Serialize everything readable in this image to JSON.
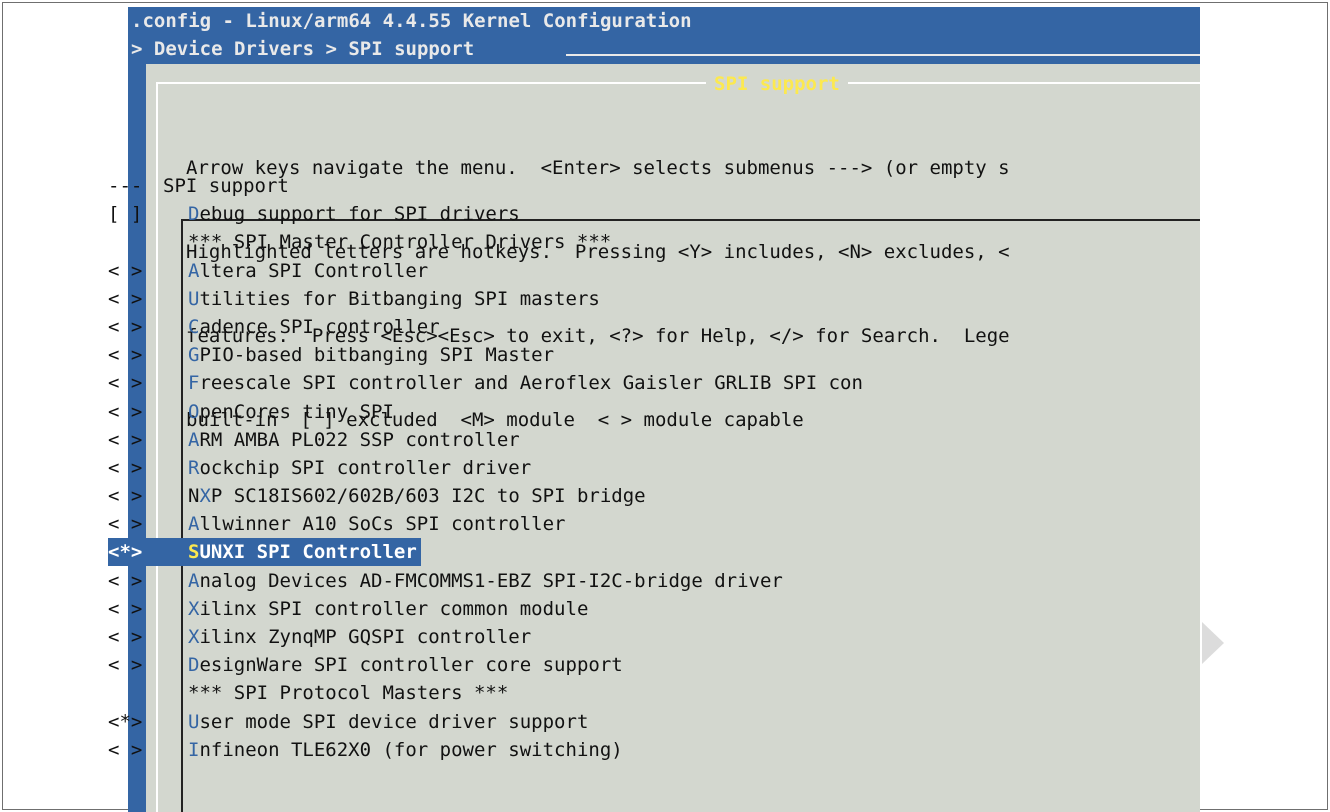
{
  "window": {
    "title": ".config - Linux/arm64 4.4.55 Kernel Configuration",
    "breadcrumb": "> Device Drivers > SPI support"
  },
  "dialog": {
    "title": "SPI support",
    "help_lines": [
      "Arrow keys navigate the menu.  <Enter> selects submenus ---> (or empty s",
      "Highlighted letters are hotkeys.  Pressing <Y> includes, <N> excludes, <",
      "features.  Press <Esc><Esc> to exit, <?> for Help, </> for Search.  Lege",
      "built-in  [ ] excluded  <M> module  < > module capable"
    ]
  },
  "menu": {
    "items": [
      {
        "flag": "---",
        "hotkey": "",
        "rest": "SPI support",
        "kind": "header"
      },
      {
        "flag": "[ ]",
        "hotkey": "D",
        "rest": "ebug support for SPI drivers"
      },
      {
        "flag": "",
        "hotkey": "",
        "rest": "*** SPI Master Controller Drivers ***",
        "kind": "comment"
      },
      {
        "flag": "< >",
        "hotkey": "A",
        "rest": "ltera SPI Controller"
      },
      {
        "flag": "< >",
        "hotkey": "U",
        "rest": "tilities for Bitbanging SPI masters"
      },
      {
        "flag": "< >",
        "hotkey": "C",
        "rest": "adence SPI controller"
      },
      {
        "flag": "< >",
        "hotkey": "G",
        "rest": "PIO-based bitbanging SPI Master"
      },
      {
        "flag": "< >",
        "hotkey": "F",
        "rest": "reescale SPI controller and Aeroflex Gaisler GRLIB SPI con"
      },
      {
        "flag": "< >",
        "hotkey": "O",
        "rest": "penCores tiny SPI"
      },
      {
        "flag": "< >",
        "hotkey": "A",
        "rest": "RM AMBA PL022 SSP controller"
      },
      {
        "flag": "< >",
        "hotkey": "R",
        "rest": "ockchip SPI controller driver"
      },
      {
        "flag": "< >",
        "prefix": "N",
        "hotkey": "X",
        "rest": "P SC18IS602/602B/603 I2C to SPI bridge"
      },
      {
        "flag": "< >",
        "hotkey": "A",
        "rest": "llwinner A10 SoCs SPI controller"
      },
      {
        "flag": "<*>",
        "hotkey": "S",
        "rest": "UNXI SPI Controller",
        "selected": true
      },
      {
        "flag": "< >",
        "hotkey": "A",
        "rest": "nalog Devices AD-FMCOMMS1-EBZ SPI-I2C-bridge driver"
      },
      {
        "flag": "< >",
        "hotkey": "X",
        "rest": "ilinx SPI controller common module"
      },
      {
        "flag": "< >",
        "hotkey": "X",
        "rest": "ilinx ZynqMP GQSPI controller"
      },
      {
        "flag": "< >",
        "hotkey": "D",
        "rest": "esignWare SPI controller core support"
      },
      {
        "flag": "",
        "hotkey": "",
        "rest": "*** SPI Protocol Masters ***",
        "kind": "comment"
      },
      {
        "flag": "<*>",
        "hotkey": "U",
        "rest": "ser mode SPI device driver support"
      },
      {
        "flag": "< >",
        "hotkey": "I",
        "rest": "nfineon TLE62X0 (for power switching)"
      }
    ]
  },
  "colors": {
    "terminal_blue": "#3465a4",
    "dialog_gray": "#d3d7cf",
    "hotkey_blue": "#3465a4",
    "title_yellow": "#fce94f"
  }
}
